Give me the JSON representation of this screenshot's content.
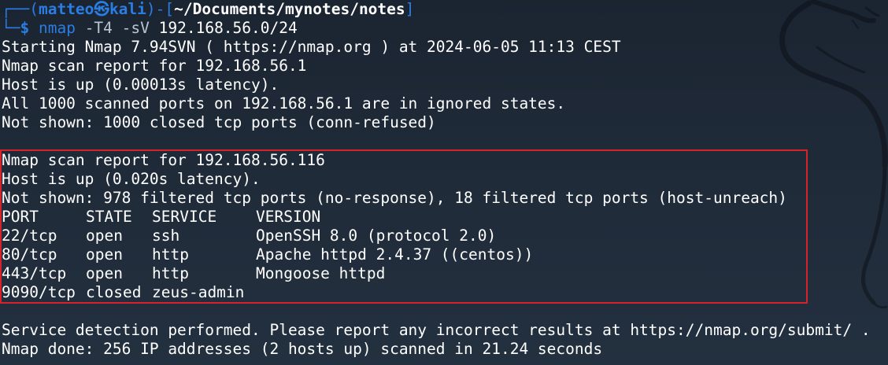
{
  "prompt": {
    "open_bracket": "┌──(",
    "user": "matteo",
    "at_symbol": "㉿",
    "host": "kali",
    "mid": ")-[",
    "cwd": "~/Documents/mynotes/notes",
    "close": "]",
    "corner": "└─",
    "dollar": "$",
    "command": "nmap",
    "args": " -T4 -sV ",
    "target": "192.168.56.0/24"
  },
  "output": {
    "starting": "Starting Nmap 7.94SVN ( https://nmap.org ) at 2024-06-05 11:13 CEST",
    "host1": {
      "report": "Nmap scan report for 192.168.56.1",
      "status": "Host is up (0.00013s latency).",
      "ports_info": "All 1000 scanned ports on 192.168.56.1 are in ignored states.",
      "not_shown": "Not shown: 1000 closed tcp ports (conn-refused)"
    },
    "host2": {
      "report": "Nmap scan report for 192.168.56.116",
      "status": "Host is up (0.020s latency).",
      "not_shown": "Not shown: 978 filtered tcp ports (no-response), 18 filtered tcp ports (host-unreach)",
      "headers": [
        "PORT",
        "STATE",
        "SERVICE",
        "VERSION"
      ],
      "rows": [
        {
          "port": "22/tcp",
          "state": "open",
          "service": "ssh",
          "version": "OpenSSH 8.0 (protocol 2.0)"
        },
        {
          "port": "80/tcp",
          "state": "open",
          "service": "http",
          "version": "Apache httpd 2.4.37 ((centos))"
        },
        {
          "port": "443/tcp",
          "state": "open",
          "service": "http",
          "version": "Mongoose httpd"
        },
        {
          "port": "9090/tcp",
          "state": "closed",
          "service": "zeus-admin",
          "version": ""
        }
      ]
    },
    "service_detection": "Service detection performed. Please report any incorrect results at https://nmap.org/submit/ .",
    "done": "Nmap done: 256 IP addresses (2 hosts up) scanned in 21.24 seconds"
  },
  "colors": {
    "background": "#1f2a38",
    "prompt_blue": "#2a7de1",
    "highlight_red": "#d8222b"
  },
  "icons": {
    "background_art": "kali-dragon-icon"
  }
}
